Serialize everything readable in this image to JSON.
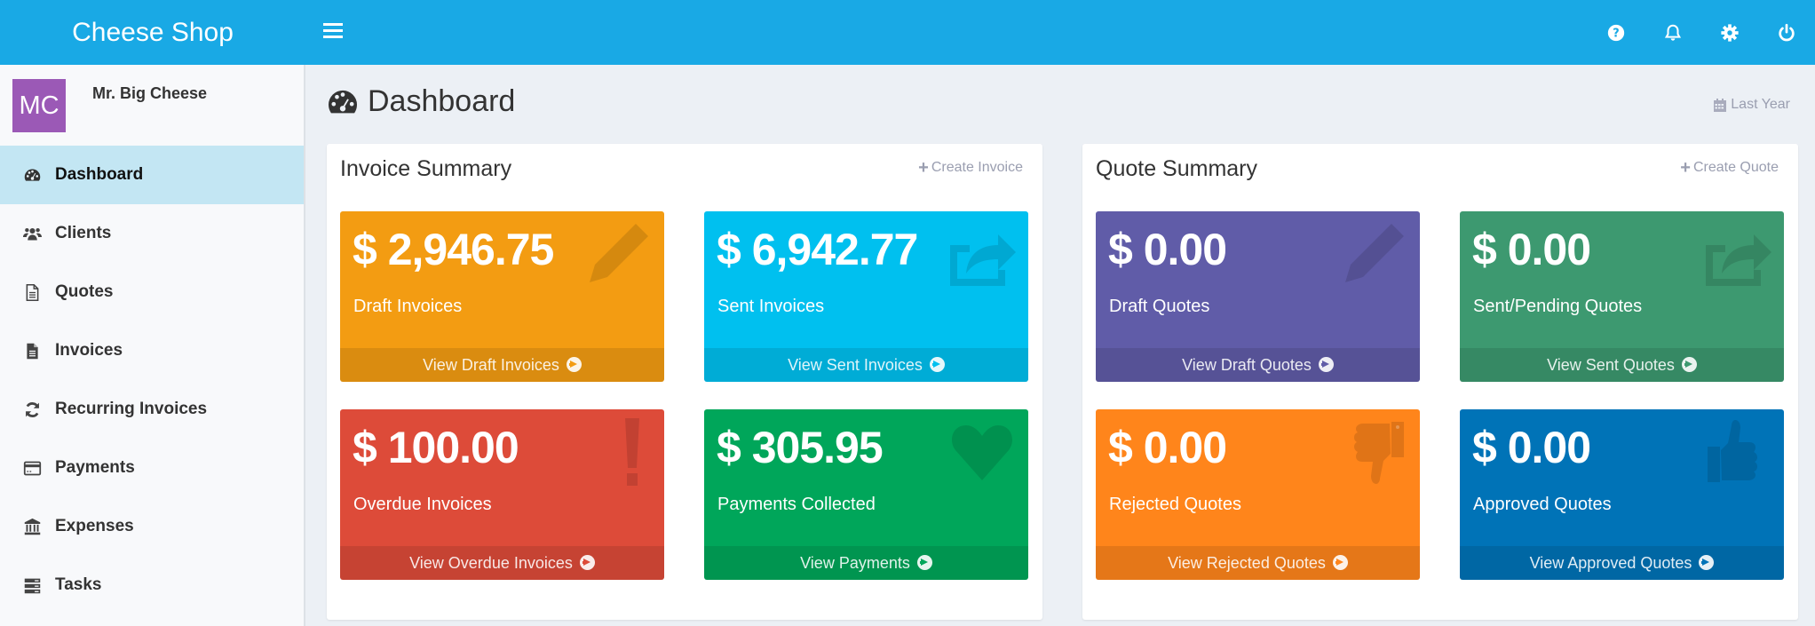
{
  "app": {
    "title": "Cheese Shop",
    "nav_icons": [
      "help-icon",
      "bell-icon",
      "gear-icon",
      "power-icon"
    ]
  },
  "user": {
    "initials": "MC",
    "name": "Mr. Big Cheese",
    "avatar_color": "#9b59b6"
  },
  "sidebar": {
    "items": [
      {
        "label": "Dashboard",
        "icon": "dashboard-icon",
        "active": true
      },
      {
        "label": "Clients",
        "icon": "users-icon",
        "active": false
      },
      {
        "label": "Quotes",
        "icon": "file-text-icon",
        "active": false
      },
      {
        "label": "Invoices",
        "icon": "file-icon",
        "active": false
      },
      {
        "label": "Recurring Invoices",
        "icon": "refresh-icon",
        "active": false
      },
      {
        "label": "Payments",
        "icon": "credit-card-icon",
        "active": false
      },
      {
        "label": "Expenses",
        "icon": "bank-icon",
        "active": false
      },
      {
        "label": "Tasks",
        "icon": "tasks-icon",
        "active": false
      }
    ]
  },
  "page": {
    "title": "Dashboard",
    "range_label": "Last Year"
  },
  "invoice_summary": {
    "title": "Invoice Summary",
    "action_label": "Create Invoice",
    "tiles": [
      {
        "amount": "$ 2,946.75",
        "label": "Draft Invoices",
        "link": "View Draft Invoices",
        "color": "#f39c12",
        "icon": "pencil-icon"
      },
      {
        "amount": "$ 6,942.77",
        "label": "Sent Invoices",
        "link": "View Sent Invoices",
        "color": "#00c0ef",
        "icon": "share-icon"
      },
      {
        "amount": "$ 100.00",
        "label": "Overdue Invoices",
        "link": "View Overdue Invoices",
        "color": "#dd4b39",
        "icon": "exclamation-icon"
      },
      {
        "amount": "$ 305.95",
        "label": "Payments Collected",
        "link": "View Payments",
        "color": "#00a65a",
        "icon": "heart-icon"
      }
    ]
  },
  "quote_summary": {
    "title": "Quote Summary",
    "action_label": "Create Quote",
    "tiles": [
      {
        "amount": "$ 0.00",
        "label": "Draft Quotes",
        "link": "View Draft Quotes",
        "color": "#605ca8",
        "icon": "pencil-icon"
      },
      {
        "amount": "$ 0.00",
        "label": "Sent/Pending Quotes",
        "link": "View Sent Quotes",
        "color": "#3d9970",
        "icon": "share-icon"
      },
      {
        "amount": "$ 0.00",
        "label": "Rejected Quotes",
        "link": "View Rejected Quotes",
        "color": "#ff851b",
        "icon": "thumbs-down-icon"
      },
      {
        "amount": "$ 0.00",
        "label": "Approved Quotes",
        "link": "View Approved Quotes",
        "color": "#0073b7",
        "icon": "thumbs-up-icon"
      }
    ]
  }
}
